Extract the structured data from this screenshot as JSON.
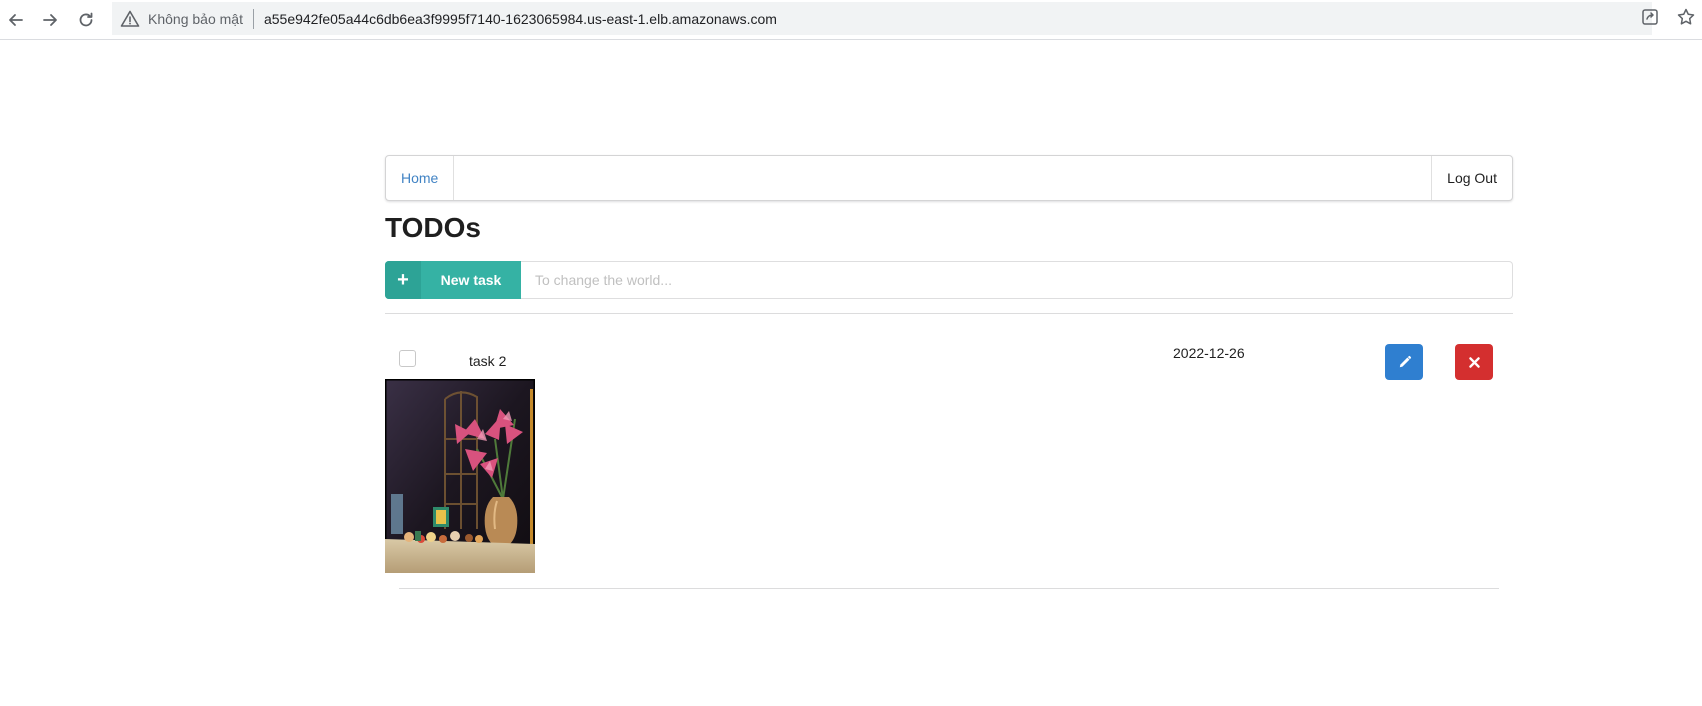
{
  "browser": {
    "security_label": "Không bảo mật",
    "url": "a55e942fe05a44c6db6ea3f9995f7140-1623065984.us-east-1.elb.amazonaws.com"
  },
  "navbar": {
    "home_label": "Home",
    "logout_label": "Log Out"
  },
  "page": {
    "title": "TODOs"
  },
  "new_task": {
    "button_label": "New task",
    "input_placeholder": "To change the world...",
    "input_value": ""
  },
  "todos": [
    {
      "name": "task 2",
      "due_date": "2022-12-26",
      "done": false,
      "attachment_icon": "photo-flowers-image"
    }
  ],
  "colors": {
    "new_task_teal": "#35b2a4",
    "edit_blue": "#2f7fd0",
    "delete_red": "#d42f2f",
    "link_blue": "#4183c4"
  }
}
